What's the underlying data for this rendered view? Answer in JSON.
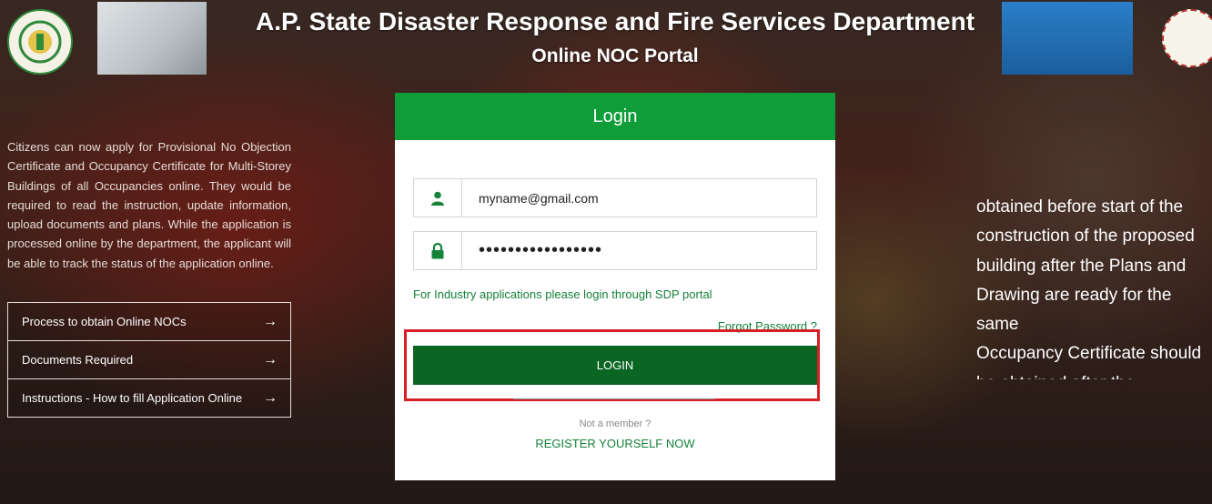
{
  "header": {
    "title": "A.P. State Disaster Response and Fire Services Department",
    "subtitle": "Online NOC Portal"
  },
  "intro_text": "Citizens can now apply for Provisional No Objection Certificate and Occupancy Certificate for Multi-Storey Buildings of all Occupancies online. They would be required to read the instruction, update information, upload documents and plans. While the application is processed online by the department, the applicant will be able to track the status of the application online.",
  "side_links": [
    {
      "label": "Process to obtain Online NOCs",
      "icon": "arrow-right-icon"
    },
    {
      "label": "Documents Required",
      "icon": "arrow-right-icon"
    },
    {
      "label": "Instructions - How to fill Application Online",
      "icon": "arrow-right-icon"
    }
  ],
  "right_panel": {
    "lines": [
      "obtained before start of the",
      "construction of the proposed",
      "building after the Plans and",
      "Drawing are ready for the",
      "same"
    ],
    "bullet_line": "Occupancy Certificate should",
    "partial_line": "be obtained after the"
  },
  "login": {
    "title": "Login",
    "email_value": "myname@gmail.com",
    "email_icon": "user-icon",
    "password_value": "•••••••••••••••••",
    "password_icon": "lock-icon",
    "industry_link": "For Industry applications please login through SDP portal",
    "forgot_link": "Forgot Password ?",
    "login_button": "LOGIN",
    "not_member": "Not a member ?",
    "register_link": "REGISTER YOURSELF NOW"
  },
  "colors": {
    "primary_green": "#0f9d3a",
    "button_green": "#0b6623",
    "link_green": "#16823a",
    "highlight_red": "#d62026"
  }
}
